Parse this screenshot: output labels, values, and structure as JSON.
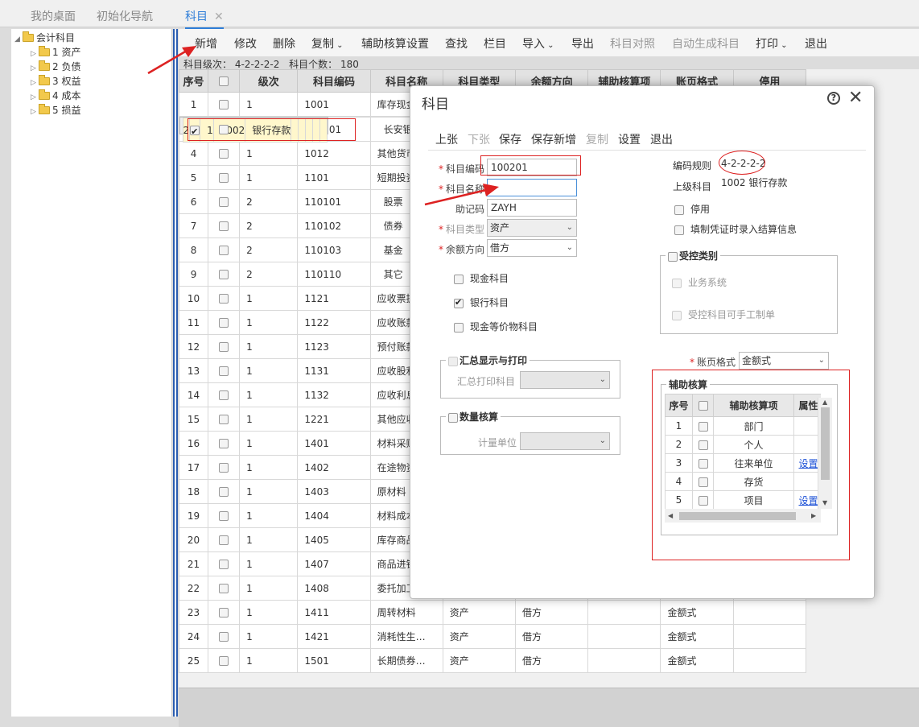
{
  "tabs": [
    {
      "label": "我的桌面"
    },
    {
      "label": "初始化导航"
    },
    {
      "label": "科目"
    }
  ],
  "tab_close": "✕",
  "tree": {
    "root": "会计科目",
    "children": [
      "1 资产",
      "2 负债",
      "3 权益",
      "4 成本",
      "5 损益"
    ]
  },
  "toolbar": {
    "add": "新增",
    "edit": "修改",
    "delete": "删除",
    "copy": "复制",
    "aux_setting": "辅助核算设置",
    "find": "查找",
    "columns": "栏目",
    "import": "导入",
    "export": "导出",
    "compare": "科目对照",
    "autogen": "自动生成科目",
    "print": "打印",
    "exit": "退出"
  },
  "info": {
    "level_label": "科目级次：",
    "level_value": "4-2-2-2-2",
    "count_label": "科目个数：",
    "count_value": "180"
  },
  "grid": {
    "headers": [
      "序号",
      "",
      "级次",
      "科目编码",
      "科目名称",
      "科目类型",
      "余额方向",
      "辅助核算项",
      "账页格式",
      "停用"
    ],
    "rows": [
      {
        "no": "1",
        "checked": false,
        "level": "1",
        "code": "1001",
        "name": "库存现金",
        "type": "",
        "dir": "",
        "aux": "",
        "fmt": ""
      },
      {
        "no": "2",
        "checked": true,
        "level": "1",
        "code": "1002",
        "name": "银行存款",
        "type": "",
        "dir": "",
        "aux": "",
        "fmt": ""
      },
      {
        "no": "3",
        "checked": false,
        "level": "2",
        "code": "100201",
        "name": "长安银行",
        "type": "",
        "dir": "",
        "aux": "",
        "fmt": ""
      },
      {
        "no": "4",
        "checked": false,
        "level": "1",
        "code": "1012",
        "name": "其他货币",
        "type": "",
        "dir": "",
        "aux": "",
        "fmt": ""
      },
      {
        "no": "5",
        "checked": false,
        "level": "1",
        "code": "1101",
        "name": "短期投资",
        "type": "",
        "dir": "",
        "aux": "",
        "fmt": ""
      },
      {
        "no": "6",
        "checked": false,
        "level": "2",
        "code": "110101",
        "name": "股票",
        "type": "",
        "dir": "",
        "aux": "",
        "fmt": ""
      },
      {
        "no": "7",
        "checked": false,
        "level": "2",
        "code": "110102",
        "name": "债券",
        "type": "",
        "dir": "",
        "aux": "",
        "fmt": ""
      },
      {
        "no": "8",
        "checked": false,
        "level": "2",
        "code": "110103",
        "name": "基金",
        "type": "",
        "dir": "",
        "aux": "",
        "fmt": ""
      },
      {
        "no": "9",
        "checked": false,
        "level": "2",
        "code": "110110",
        "name": "其它",
        "type": "",
        "dir": "",
        "aux": "",
        "fmt": ""
      },
      {
        "no": "10",
        "checked": false,
        "level": "1",
        "code": "1121",
        "name": "应收票据",
        "type": "",
        "dir": "",
        "aux": "",
        "fmt": ""
      },
      {
        "no": "11",
        "checked": false,
        "level": "1",
        "code": "1122",
        "name": "应收账款",
        "type": "",
        "dir": "",
        "aux": "",
        "fmt": ""
      },
      {
        "no": "12",
        "checked": false,
        "level": "1",
        "code": "1123",
        "name": "预付账款",
        "type": "",
        "dir": "",
        "aux": "",
        "fmt": ""
      },
      {
        "no": "13",
        "checked": false,
        "level": "1",
        "code": "1131",
        "name": "应收股利",
        "type": "",
        "dir": "",
        "aux": "",
        "fmt": ""
      },
      {
        "no": "14",
        "checked": false,
        "level": "1",
        "code": "1132",
        "name": "应收利息",
        "type": "",
        "dir": "",
        "aux": "",
        "fmt": ""
      },
      {
        "no": "15",
        "checked": false,
        "level": "1",
        "code": "1221",
        "name": "其他应收",
        "type": "",
        "dir": "",
        "aux": "",
        "fmt": ""
      },
      {
        "no": "16",
        "checked": false,
        "level": "1",
        "code": "1401",
        "name": "材料采购",
        "type": "",
        "dir": "",
        "aux": "",
        "fmt": ""
      },
      {
        "no": "17",
        "checked": false,
        "level": "1",
        "code": "1402",
        "name": "在途物资",
        "type": "",
        "dir": "",
        "aux": "",
        "fmt": ""
      },
      {
        "no": "18",
        "checked": false,
        "level": "1",
        "code": "1403",
        "name": "原材料",
        "type": "",
        "dir": "",
        "aux": "",
        "fmt": ""
      },
      {
        "no": "19",
        "checked": false,
        "level": "1",
        "code": "1404",
        "name": "材料成本",
        "type": "",
        "dir": "",
        "aux": "",
        "fmt": ""
      },
      {
        "no": "20",
        "checked": false,
        "level": "1",
        "code": "1405",
        "name": "库存商品",
        "type": "",
        "dir": "",
        "aux": "",
        "fmt": ""
      },
      {
        "no": "21",
        "checked": false,
        "level": "1",
        "code": "1407",
        "name": "商品进销",
        "type": "",
        "dir": "",
        "aux": "",
        "fmt": ""
      },
      {
        "no": "22",
        "checked": false,
        "level": "1",
        "code": "1408",
        "name": "委托加工…",
        "type": "资产",
        "dir": "借方",
        "aux": "",
        "fmt": "金额式"
      },
      {
        "no": "23",
        "checked": false,
        "level": "1",
        "code": "1411",
        "name": "周转材料",
        "type": "资产",
        "dir": "借方",
        "aux": "",
        "fmt": "金额式"
      },
      {
        "no": "24",
        "checked": false,
        "level": "1",
        "code": "1421",
        "name": "消耗性生…",
        "type": "资产",
        "dir": "借方",
        "aux": "",
        "fmt": "金额式"
      },
      {
        "no": "25",
        "checked": false,
        "level": "1",
        "code": "1501",
        "name": "长期债券…",
        "type": "资产",
        "dir": "借方",
        "aux": "",
        "fmt": "金额式"
      }
    ]
  },
  "dialog": {
    "title": "科目",
    "help": "?",
    "close": "✕",
    "toolbar": {
      "prev": "上张",
      "next": "下张",
      "save": "保存",
      "save_new": "保存新增",
      "copy": "复制",
      "settings": "设置",
      "exit": "退出"
    },
    "form": {
      "code_label": "科目编码",
      "code_value": "100201",
      "name_label": "科目名称",
      "name_value": "",
      "mnemonic_label": "助记码",
      "mnemonic_value": "ZAYH",
      "type_label": "科目类型",
      "type_value": "资产",
      "dir_label": "余额方向",
      "dir_value": "借方",
      "cash_label": "现金科目",
      "bank_label": "银行科目",
      "cash_equiv_label": "现金等价物科目",
      "rule_label": "编码规则",
      "rule_value": "4-2-2-2-2",
      "parent_label": "上级科目",
      "parent_value": "1002  银行存款",
      "disable_label": "停用",
      "settle_label": "填制凭证时录入结算信息",
      "controlled_legend": "受控类别",
      "biz_system_label": "业务系统",
      "manual_label": "受控科目可手工制单",
      "summary_legend": "汇总显示与打印",
      "summary_print_label": "汇总打印科目",
      "qty_legend": "数量核算",
      "unit_label": "计量单位",
      "page_fmt_label": "账页格式",
      "page_fmt_value": "金额式",
      "aux_legend": "辅助核算"
    },
    "aux_table": {
      "headers": [
        "序号",
        "",
        "辅助核算项",
        "属性"
      ],
      "rows": [
        {
          "no": "1",
          "item": "部门",
          "attr": ""
        },
        {
          "no": "2",
          "item": "个人",
          "attr": ""
        },
        {
          "no": "3",
          "item": "往来单位",
          "attr": "设置"
        },
        {
          "no": "4",
          "item": "存货",
          "attr": ""
        },
        {
          "no": "5",
          "item": "项目",
          "attr": "设置"
        }
      ]
    }
  },
  "colors": {
    "accent": "#2f7ed8",
    "annotation": "#dd2222",
    "selected_row": "#fff7cc"
  }
}
